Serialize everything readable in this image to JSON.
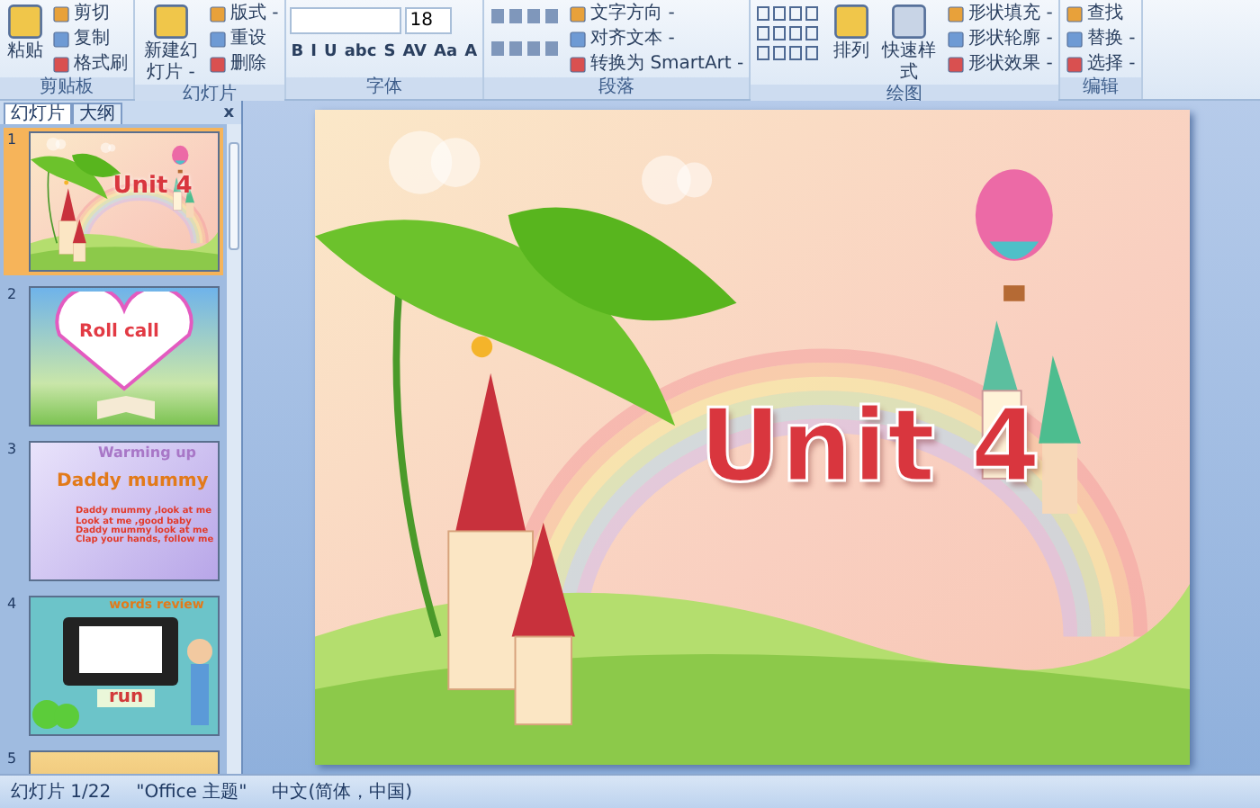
{
  "ribbon": {
    "groups": [
      {
        "label": "剪贴板",
        "large": [
          "粘贴"
        ],
        "small": [
          "剪切",
          "复制",
          "格式刷"
        ]
      },
      {
        "label": "幻灯片",
        "large": [
          "新建幻灯片 -"
        ],
        "small": [
          "版式 -",
          "重设",
          "删除"
        ]
      },
      {
        "label": "字体",
        "font_size": {
          "value": "18"
        },
        "format_buttons": [
          "B",
          "I",
          "U",
          "abc",
          "S",
          "AV",
          "Aa",
          "A"
        ]
      },
      {
        "label": "段落",
        "small": [
          "文字方向 -",
          "对齐文本 -",
          "转换为 SmartArt -"
        ]
      },
      {
        "label": "绘图",
        "large": [
          "排列",
          "快速样式"
        ],
        "small": [
          "形状填充 -",
          "形状轮廓 -",
          "形状效果 -"
        ]
      },
      {
        "label": "编辑",
        "small": [
          "查找",
          "替换 -",
          "选择 -"
        ]
      }
    ]
  },
  "pane_tabs": [
    {
      "label": "幻灯片",
      "selected": true
    },
    {
      "label": "大纲",
      "selected": false
    }
  ],
  "pane_close": "x",
  "thumbnails": [
    {
      "number": "1",
      "kind": "title",
      "selected": true,
      "title": "Unit 4"
    },
    {
      "number": "2",
      "kind": "roll_call",
      "selected": false,
      "title": "Roll call"
    },
    {
      "number": "3",
      "kind": "song",
      "selected": false,
      "heading": "Warming up",
      "title": "Daddy mummy",
      "lines": [
        "Daddy mummy ,look at me",
        "Look at me ,good baby",
        "Daddy mummy look at me",
        "Clap your hands, follow me"
      ]
    },
    {
      "number": "4",
      "kind": "review",
      "selected": false,
      "heading": "words review",
      "title": "run"
    },
    {
      "number": "5",
      "kind": "partial",
      "selected": false
    }
  ],
  "slide": {
    "title": "Unit 4"
  },
  "status_bar": [
    "幻灯片 1/22",
    "\"Office 主题\"",
    "中文(简体，中国)"
  ]
}
